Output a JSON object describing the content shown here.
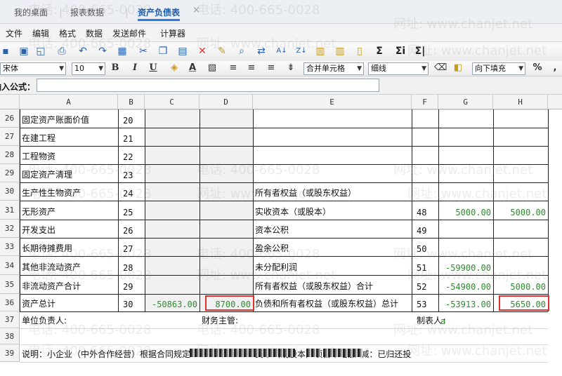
{
  "tabs": [
    {
      "label": "我的桌面",
      "active": false
    },
    {
      "label": "报表数据",
      "active": false
    },
    {
      "label": "资产负债表",
      "active": true
    }
  ],
  "tab_close_glyph": "×",
  "menu": [
    "文件",
    "编辑",
    "格式",
    "数据",
    "发送邮件",
    "计算器"
  ],
  "toolbar": {
    "font": "宋体",
    "size": "10",
    "bold": "B",
    "italic": "I",
    "underline": "U",
    "font_color": "A",
    "merge": "合并单元格",
    "border": "细线",
    "fill_mode": "向下填充",
    "percent": "%",
    "sum1": "Σ",
    "sum2": "Σi",
    "sum3": "Σ|",
    "sort_asc": "A↓",
    "sort_desc": "Z↓"
  },
  "formula": {
    "label": "输入公式：",
    "value": ""
  },
  "columns": [
    "A",
    "B",
    "C",
    "D",
    "E",
    "F",
    "G",
    "H"
  ],
  "rows": [
    {
      "row": "26",
      "a": "固定资产账面价值",
      "b": "20",
      "c": "",
      "d": "",
      "e": "",
      "f": "",
      "g": "",
      "h": ""
    },
    {
      "row": "27",
      "a": "在建工程",
      "b": "21",
      "c": "",
      "d": "",
      "e": "",
      "f": "",
      "g": "",
      "h": ""
    },
    {
      "row": "28",
      "a": "工程物资",
      "b": "22",
      "c": "",
      "d": "",
      "e": "",
      "f": "",
      "g": "",
      "h": ""
    },
    {
      "row": "29",
      "a": "固定资产清理",
      "b": "23",
      "c": "",
      "d": "",
      "e": "",
      "f": "",
      "g": "",
      "h": ""
    },
    {
      "row": "30",
      "a": "生产性生物资产",
      "b": "24",
      "c": "",
      "d": "",
      "e": "所有者权益（或股东权益）",
      "f": "",
      "g": "",
      "h": ""
    },
    {
      "row": "31",
      "a": "无形资产",
      "b": "25",
      "c": "",
      "d": "",
      "e": "实收资本（或股本）",
      "f": "48",
      "g": "5000.00",
      "h": "5000.00"
    },
    {
      "row": "32",
      "a": "开发支出",
      "b": "26",
      "c": "",
      "d": "",
      "e": "资本公积",
      "f": "49",
      "g": "",
      "h": ""
    },
    {
      "row": "33",
      "a": "长期待摊费用",
      "b": "27",
      "c": "",
      "d": "",
      "e": "盈余公积",
      "f": "50",
      "g": "",
      "h": ""
    },
    {
      "row": "34",
      "a": "其他非流动资产",
      "b": "28",
      "c": "",
      "d": "",
      "e": "未分配利润",
      "f": "51",
      "g": "-59900.00",
      "h": ""
    },
    {
      "row": "35",
      "a": "非流动资产合计",
      "b": "29",
      "c": "",
      "d": "",
      "e": "所有者权益（或股东权益）合计",
      "f": "52",
      "g": "-54900.00",
      "h": "5000.00"
    },
    {
      "row": "36",
      "a": "资产总计",
      "b": "30",
      "c": "-50863.00",
      "d": "8700.00",
      "e": "负债和所有者权益（或股东权益）总计",
      "f": "53",
      "g": "-53913.00",
      "h": "5650.00"
    },
    {
      "row": "37",
      "a": "单位负责人:",
      "b": "",
      "c": "",
      "d": "财务主管:",
      "e": "",
      "f": "制表人:",
      "g": "a",
      "h": ""
    },
    {
      "row": "38",
      "a": "",
      "b": "",
      "c": "",
      "d": "",
      "e": "",
      "f": "",
      "g": "",
      "h": ""
    },
    {
      "row": "39",
      "a": "说明：小企业（中外合作经营）根据合同规定",
      "b": "",
      "c": "",
      "d": "",
      "e": "资本（或股本）”项目下增加“减：已归还投",
      "f": "",
      "g": "",
      "h": ""
    }
  ],
  "watermark": {
    "phone": "电话: 400-665-0028",
    "site": "网址: www.chanjet.net"
  }
}
